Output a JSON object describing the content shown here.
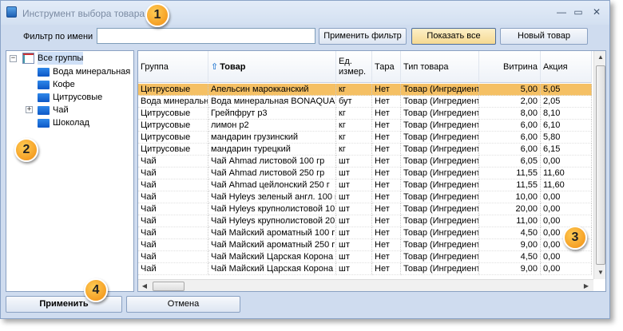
{
  "window": {
    "title": "Инструмент выбора товара",
    "minimize_icon": "—",
    "maximize_icon": "▭",
    "close_icon": "✕"
  },
  "filter": {
    "label": "Фильтр по имени",
    "value": "",
    "placeholder": ""
  },
  "toolbar": {
    "apply_filter": "Применить фильтр",
    "show_all": "Показать все",
    "new_item": "Новый товар"
  },
  "tree": {
    "root": {
      "label": "Все группы",
      "toggle": "−"
    },
    "items": [
      {
        "label": "Вода минеральная",
        "toggle": ""
      },
      {
        "label": "Кофе",
        "toggle": ""
      },
      {
        "label": "Цитрусовые",
        "toggle": ""
      },
      {
        "label": "Чай",
        "toggle": "+"
      },
      {
        "label": "Шоколад",
        "toggle": ""
      }
    ]
  },
  "grid": {
    "columns": [
      "Группа",
      "Товар",
      "Ед. измер.",
      "Тара",
      "Тип товара",
      "Витрина",
      "Акция"
    ],
    "sort_icon": "⇧",
    "rows": [
      [
        "Цитрусовые",
        "Апельсин марокканский",
        "кг",
        "Нет",
        "Товар (Ингредиент",
        "5,00",
        "5,05"
      ],
      [
        "Вода минеральн",
        "Вода минеральная BONAQUA",
        "бут",
        "Нет",
        "Товар (Ингредиент",
        "2,00",
        "2,05"
      ],
      [
        "Цитрусовые",
        "Грейпфрут р3",
        "кг",
        "Нет",
        "Товар (Ингредиент",
        "8,00",
        "8,10"
      ],
      [
        "Цитрусовые",
        "лимон р2",
        "кг",
        "Нет",
        "Товар (Ингредиент",
        "6,00",
        "6,10"
      ],
      [
        "Цитрусовые",
        "мандарин грузинский",
        "кг",
        "Нет",
        "Товар (Ингредиент",
        "6,00",
        "5,80"
      ],
      [
        "Цитрусовые",
        "мандарин турецкий",
        "кг",
        "Нет",
        "Товар (Ингредиент",
        "6,00",
        "6,15"
      ],
      [
        "Чай",
        "Чай Ahmad листовой 100 гр",
        "шт",
        "Нет",
        "Товар (Ингредиент",
        "6,05",
        "0,00"
      ],
      [
        "Чай",
        "Чай Ahmad листовой 250 гр",
        "шт",
        "Нет",
        "Товар (Ингредиент",
        "11,55",
        "11,60"
      ],
      [
        "Чай",
        "Чай Ahmad цейлонский 250 г",
        "шт",
        "Нет",
        "Товар (Ингредиент",
        "11,55",
        "11,60"
      ],
      [
        "Чай",
        "Чай Hyleys зеленый англ. 100 г",
        "шт",
        "Нет",
        "Товар (Ингредиент",
        "10,00",
        "0,00"
      ],
      [
        "Чай",
        "Чай Hyleys крупнолистовой 10",
        "шт",
        "Нет",
        "Товар (Ингредиент",
        "20,00",
        "0,00"
      ],
      [
        "Чай",
        "Чай Hyleys крупнолистовой 20",
        "шт",
        "Нет",
        "Товар (Ингредиент",
        "11,00",
        "0,00"
      ],
      [
        "Чай",
        "Чай Майский ароматный 100 г",
        "шт",
        "Нет",
        "Товар (Ингредиент",
        "4,50",
        "0,00"
      ],
      [
        "Чай",
        "Чай Майский ароматный 250 г",
        "шт",
        "Нет",
        "Товар (Ингредиент",
        "9,00",
        "0,00"
      ],
      [
        "Чай",
        "Чай Майский Царская Корона 1",
        "шт",
        "Нет",
        "Товар (Ингредиент",
        "4,50",
        "0,00"
      ],
      [
        "Чай",
        "Чай Майский Царская Корона 2",
        "шт",
        "Нет",
        "Товар (Ингредиент",
        "9,00",
        "0,00"
      ]
    ],
    "selected_row": 0
  },
  "footer": {
    "apply": "Применить",
    "cancel": "Отмена"
  },
  "badges": [
    "1",
    "2",
    "3",
    "4"
  ],
  "colors": {
    "selected_row": "#f5c064",
    "badge": "#f18c10",
    "window_bg": "#cfdcef"
  }
}
